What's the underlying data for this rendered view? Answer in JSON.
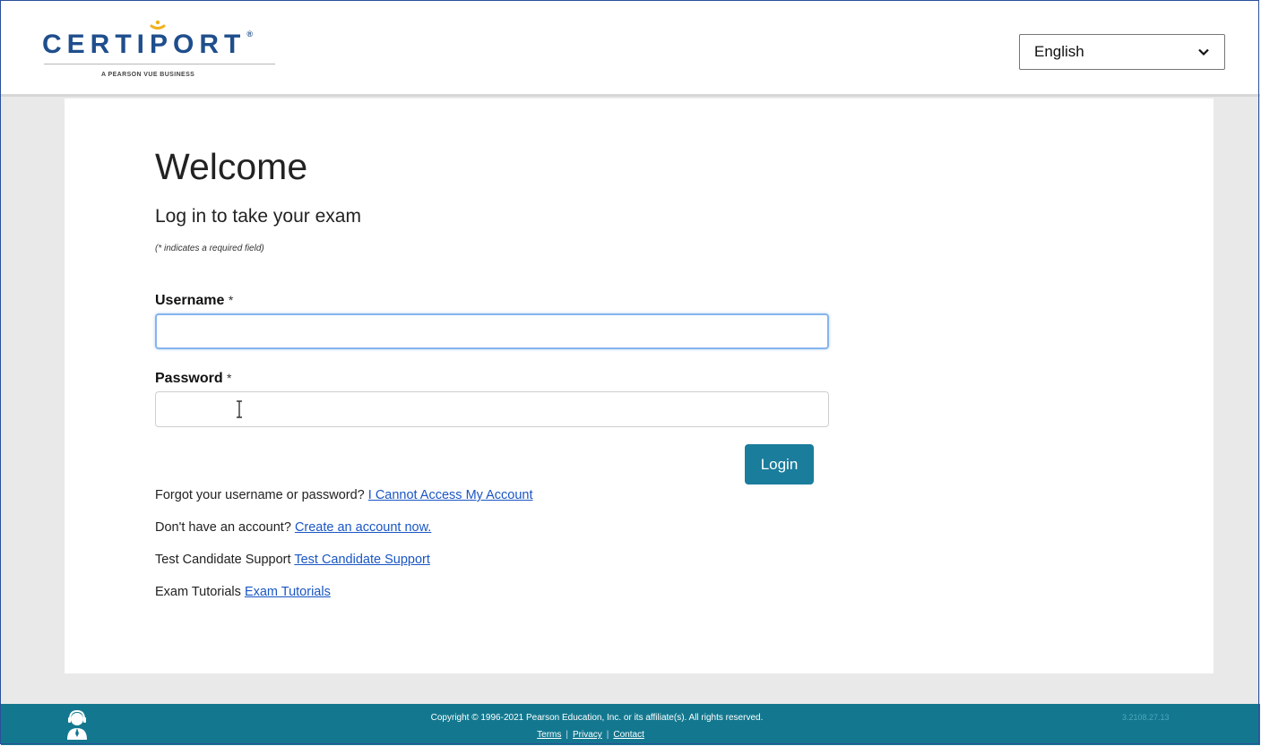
{
  "header": {
    "logo_text": "CERT",
    "logo_text_end": "PORT",
    "logo_tagline": "A PEARSON VUE BUSINESS",
    "language_selected": "English"
  },
  "main": {
    "title": "Welcome",
    "subtitle": "Log in to take your exam",
    "required_note": "(* indicates a required field)",
    "username_label": "Username",
    "password_label": "Password",
    "required_marker": "*",
    "username_value": "",
    "password_value": "",
    "login_label": "Login",
    "links": [
      {
        "prefix": "Forgot your username or password?",
        "link": "I Cannot Access My Account"
      },
      {
        "prefix": "Don't have an account?",
        "link": "Create an account now."
      },
      {
        "prefix": "Test Candidate Support",
        "link": "Test Candidate Support"
      },
      {
        "prefix": "Exam Tutorials",
        "link": "Exam Tutorials"
      }
    ]
  },
  "footer": {
    "copyright": "Copyright © 1996-2021 Pearson Education, Inc. or its affiliate(s). All rights reserved.",
    "terms": "Terms",
    "privacy": "Privacy",
    "contact": "Contact",
    "separator": "|",
    "version": "3.2108.27.13"
  },
  "colors": {
    "brand_blue": "#1f4e8c",
    "accent_teal": "#1a7d9c",
    "footer_teal": "#13788f",
    "link_blue": "#1a56c4"
  }
}
